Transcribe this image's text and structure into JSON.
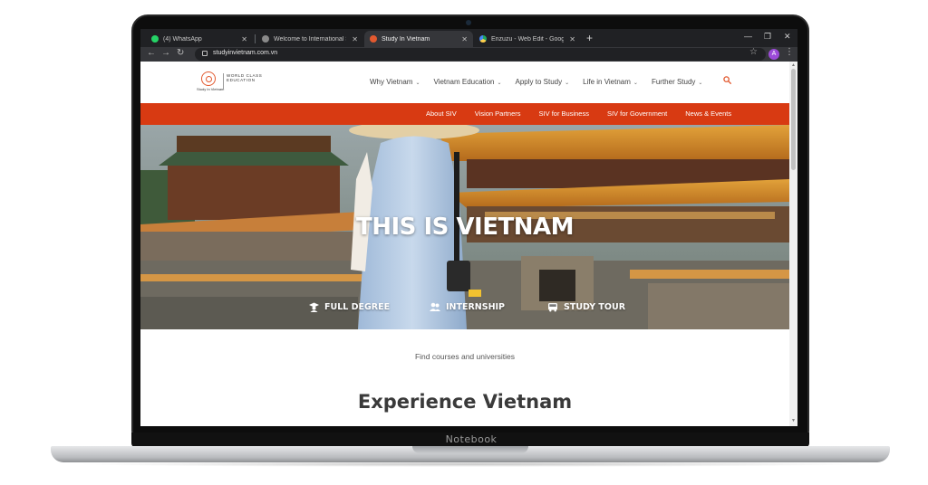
{
  "device": {
    "brand": "Notebook"
  },
  "browser": {
    "tabs": [
      {
        "label": "(4) WhatsApp",
        "active": false
      },
      {
        "label": "Welcome to International Studies",
        "active": false
      },
      {
        "label": "Study In Vietnam",
        "active": true
      },
      {
        "label": "Enzuzu - Web Edit - Google Drive",
        "active": false
      }
    ],
    "url": "studyinvietnam.com.vn",
    "profile_initial": "A"
  },
  "site": {
    "logo": {
      "tagline": "Study In Vietnam",
      "wordmark": "WORLD CLASS EDUCATION"
    },
    "nav": [
      {
        "label": "Why Vietnam"
      },
      {
        "label": "Vietnam Education"
      },
      {
        "label": "Apply to Study"
      },
      {
        "label": "Life in Vietnam"
      },
      {
        "label": "Further Study"
      }
    ],
    "subnav": [
      {
        "label": "About SIV"
      },
      {
        "label": "Vision Partners"
      },
      {
        "label": "SIV for Business"
      },
      {
        "label": "SIV for Government"
      },
      {
        "label": "News & Events"
      }
    ],
    "hero": {
      "title": "THIS IS VIETNAM",
      "links": [
        {
          "label": "FULL DEGREE",
          "icon": "graduate-icon"
        },
        {
          "label": "INTERNSHIP",
          "icon": "users-icon"
        },
        {
          "label": "STUDY TOUR",
          "icon": "bus-icon"
        }
      ]
    },
    "find_text": "Find courses and universities",
    "section_title": "Experience Vietnam"
  },
  "colors": {
    "accent": "#d83a12",
    "browser_dark": "#202124",
    "toolbar": "#35363a"
  }
}
